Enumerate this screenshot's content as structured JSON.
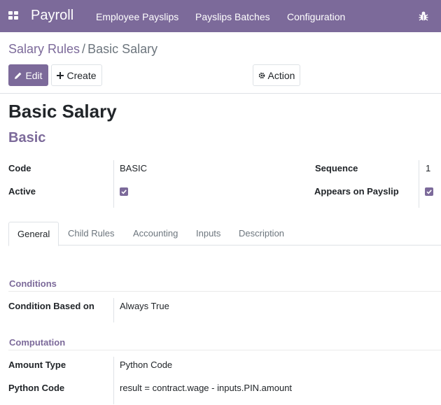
{
  "navbar": {
    "brand": "Payroll",
    "menu": [
      "Employee Payslips",
      "Payslips Batches",
      "Configuration"
    ]
  },
  "breadcrumb": {
    "parent": "Salary Rules",
    "separator": "/",
    "current": "Basic Salary"
  },
  "buttons": {
    "edit": "Edit",
    "create": "Create",
    "action": "Action"
  },
  "record": {
    "title": "Basic Salary",
    "subtitle": "Basic",
    "fields": {
      "code_label": "Code",
      "code_value": "BASIC",
      "active_label": "Active",
      "active_value": true,
      "sequence_label": "Sequence",
      "sequence_value": "1",
      "appears_label": "Appears on Payslip",
      "appears_value": true
    }
  },
  "tabs": [
    "General",
    "Child Rules",
    "Accounting",
    "Inputs",
    "Description"
  ],
  "active_tab": "General",
  "conditions": {
    "heading": "Conditions",
    "based_on_label": "Condition Based on",
    "based_on_value": "Always True"
  },
  "computation": {
    "heading": "Computation",
    "amount_type_label": "Amount Type",
    "amount_type_value": "Python Code",
    "python_code_label": "Python Code",
    "python_code_value": "result = contract.wage - inputs.PIN.amount"
  },
  "colors": {
    "brand": "#7c6a9a",
    "border": "#dee2e6"
  }
}
